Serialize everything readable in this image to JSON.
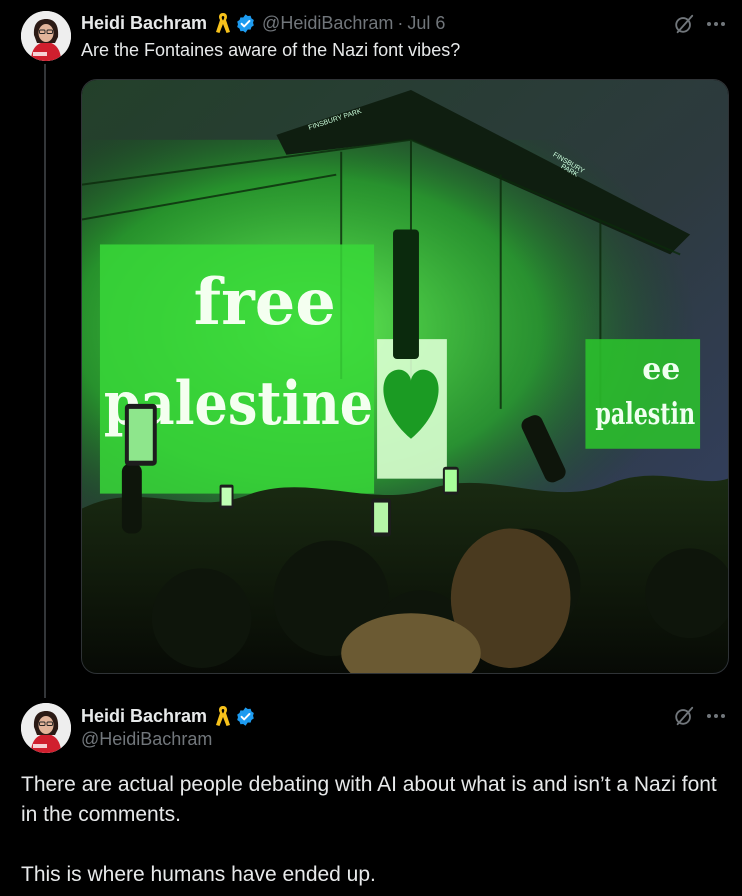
{
  "tweet1": {
    "author_name": "Heidi Bachram",
    "author_handle": "@HeidiBachram",
    "separator": "·",
    "date": "Jul 6",
    "text": "Are the Fontaines aware of the Nazi font vibes?",
    "ribbon_icon": "yellow-ribbon-icon",
    "verified_icon": "verified-badge-icon",
    "media": {
      "banner_left": "FINSBURY PARK",
      "banner_right_line1": "FINSBURY",
      "banner_right_line2": "PARK",
      "screen_left_line1": "free",
      "screen_left_line2": "palestine",
      "screen_right_line1": "ee",
      "screen_right_line2": "palestin"
    }
  },
  "tweet2": {
    "author_name": "Heidi Bachram",
    "author_handle": "@HeidiBachram",
    "ribbon_icon": "yellow-ribbon-icon",
    "verified_icon": "verified-badge-icon",
    "paragraph1": "There are actual people debating with AI about what is and isn’t a Nazi font in the comments.",
    "paragraph2": "This is where humans have ended up."
  },
  "colors": {
    "background": "#000000",
    "text_primary": "#e7e9ea",
    "text_secondary": "#71767b",
    "verified": "#1d9bf0",
    "ribbon": "#f7c21b",
    "stage_green": "#3ce83c"
  }
}
